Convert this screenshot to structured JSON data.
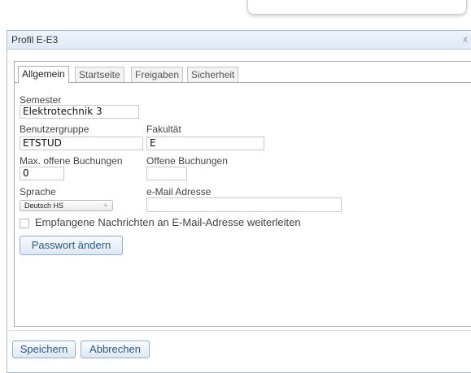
{
  "dialog": {
    "title": "Profil E-E3",
    "close_glyph": "x"
  },
  "tabs": [
    {
      "label": "Allgemein"
    },
    {
      "label": "Startseite"
    },
    {
      "label": "Freigaben"
    },
    {
      "label": "Sicherheit"
    }
  ],
  "form": {
    "semester_label": "Semester",
    "semester_value": "Elektrotechnik 3",
    "group_label": "Benutzergruppe",
    "group_value": "ETSTUD",
    "faculty_label": "Fakultät",
    "faculty_value": "E",
    "max_bookings_label": "Max. offene Buchungen",
    "max_bookings_value": "0",
    "open_bookings_label": "Offene Buchungen",
    "open_bookings_value": "",
    "language_label": "Sprache",
    "language_value": "Deutsch HS",
    "language_arrow": "÷",
    "email_label": "e-Mail Adresse",
    "email_value": "",
    "forward_label": "Empfangene Nachrichten an E-Mail-Adresse weiterleiten",
    "forward_checked": false,
    "change_password_label": "Passwort ändern"
  },
  "footer": {
    "save_label": "Speichern",
    "cancel_label": "Abbrechen"
  }
}
